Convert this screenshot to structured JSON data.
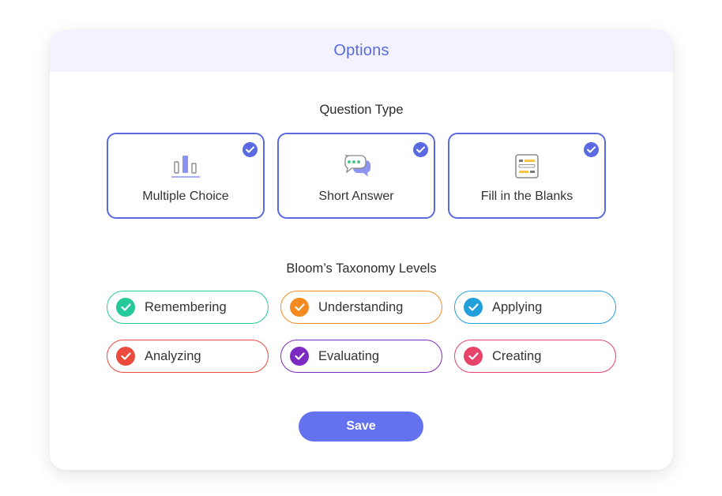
{
  "dialog": {
    "title": "Options",
    "accent_color": "#5a6ae0",
    "header_bg": "#f2f3fe"
  },
  "question_type": {
    "title": "Question Type",
    "options": [
      {
        "label": "Multiple Choice",
        "icon": "bar-chart-icon",
        "selected": true
      },
      {
        "label": "Short Answer",
        "icon": "chat-bubbles-icon",
        "selected": true
      },
      {
        "label": "Fill in the Blanks",
        "icon": "form-lines-icon",
        "selected": true
      }
    ]
  },
  "blooms": {
    "title": "Bloom’s Taxonomy Levels",
    "levels": [
      {
        "label": "Remembering",
        "color": "#26c99a",
        "checked": true
      },
      {
        "label": "Understanding",
        "color": "#f58a1f",
        "checked": true
      },
      {
        "label": "Applying",
        "color": "#22a0dc",
        "checked": true
      },
      {
        "label": "Analyzing",
        "color": "#eb4a3c",
        "checked": true
      },
      {
        "label": "Evaluating",
        "color": "#7b2bc2",
        "checked": true
      },
      {
        "label": "Creating",
        "color": "#e8436b",
        "checked": true
      }
    ]
  },
  "actions": {
    "save_label": "Save",
    "save_color": "#6472f0"
  }
}
